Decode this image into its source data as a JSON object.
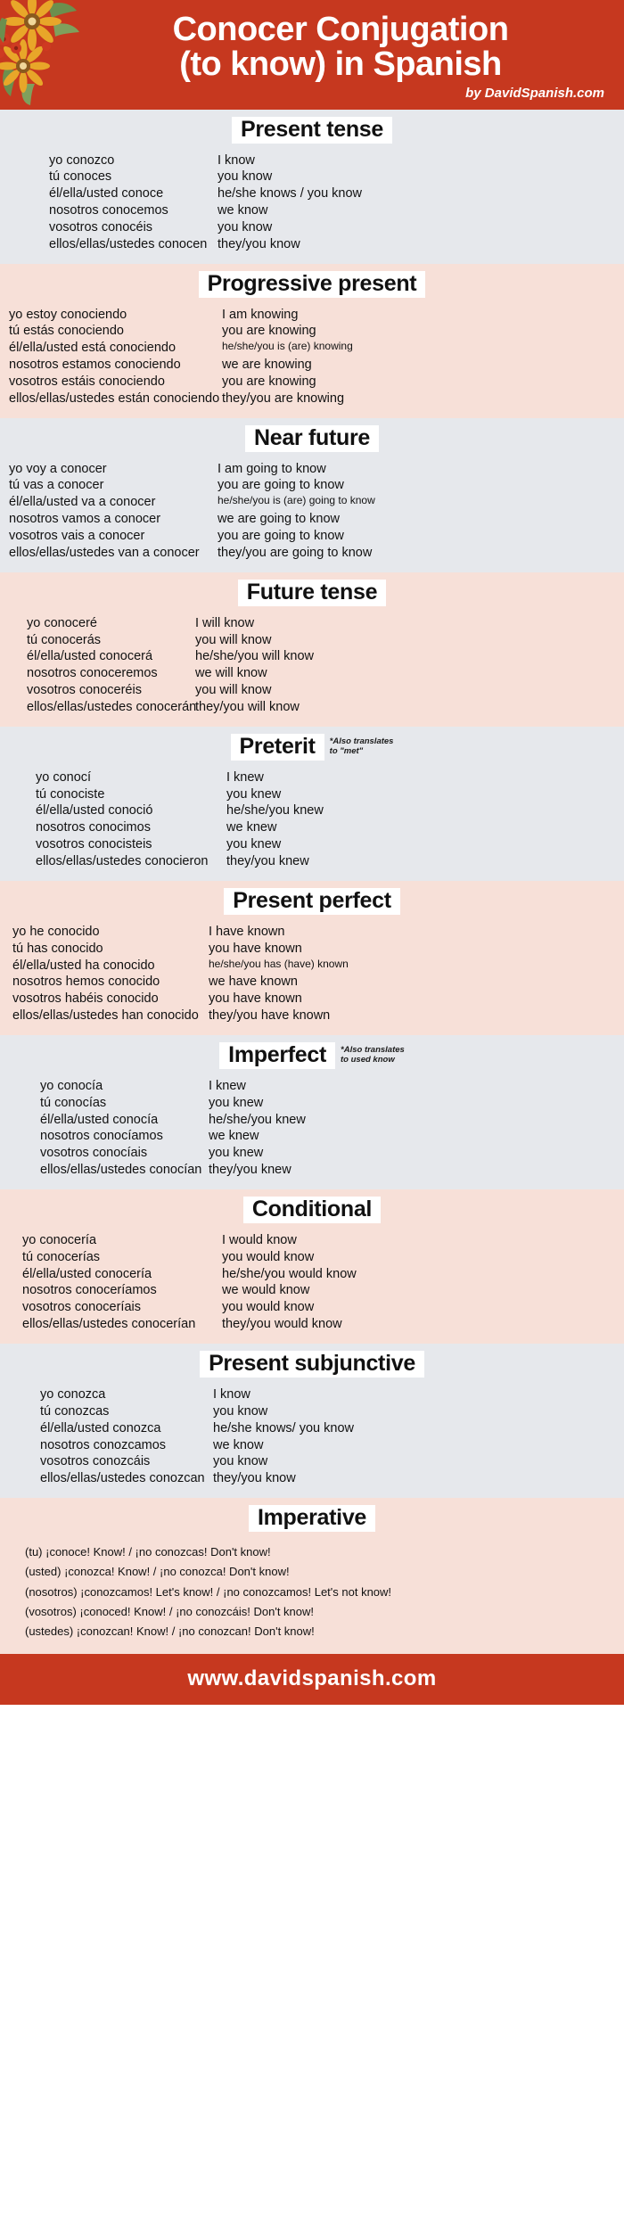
{
  "header": {
    "title_line1": "Conocer Conjugation",
    "title_line2": "(to know) in Spanish",
    "byline": "by DavidSpanish.com",
    "bg_color": "#c6381f",
    "text_color": "#ffffff",
    "decoration_icon": "sunflower-floral-icon"
  },
  "colors": {
    "brand_red": "#c6381f",
    "section_grey": "#e6e8ec",
    "section_pink": "#f7e0d8",
    "title_chip": "#ffffff",
    "body_text": "#111111"
  },
  "sections": [
    {
      "id": "present",
      "title": "Present tense",
      "note": "",
      "bg": "grey",
      "rows": [
        {
          "es": "yo conozco",
          "en": "I know"
        },
        {
          "es": "tú conoces",
          "en": "you know"
        },
        {
          "es": "él/ella/usted conoce",
          "en": "he/she knows / you know"
        },
        {
          "es": "nosotros conocemos",
          "en": "we know"
        },
        {
          "es": "vosotros conocéis",
          "en": "you know"
        },
        {
          "es": "ellos/ellas/ustedes conocen",
          "en": "they/you know"
        }
      ]
    },
    {
      "id": "progressive-present",
      "title": "Progressive present",
      "note": "",
      "bg": "pink",
      "rows": [
        {
          "es": "yo estoy conociendo",
          "en": "I am knowing"
        },
        {
          "es": "tú estás conociendo",
          "en": "you are knowing"
        },
        {
          "es": "él/ella/usted está conociendo",
          "en": "he/she/you is (are) knowing"
        },
        {
          "es": "nosotros estamos conociendo",
          "en": "we are knowing"
        },
        {
          "es": "vosotros estáis conociendo",
          "en": "you are knowing"
        },
        {
          "es": "ellos/ellas/ustedes están conociendo",
          "en": "they/you are knowing"
        }
      ]
    },
    {
      "id": "near-future",
      "title": "Near future",
      "note": "",
      "bg": "grey",
      "rows": [
        {
          "es": "yo voy a conocer",
          "en": "I am going to know"
        },
        {
          "es": "tú vas a conocer",
          "en": "you are going to know"
        },
        {
          "es": "él/ella/usted va a conocer",
          "en": "he/she/you is (are) going to know"
        },
        {
          "es": "nosotros vamos a conocer",
          "en": "we are going to know"
        },
        {
          "es": "vosotros vais a conocer",
          "en": "you are going to know"
        },
        {
          "es": "ellos/ellas/ustedes van a conocer",
          "en": "they/you are going to know"
        }
      ]
    },
    {
      "id": "future",
      "title": "Future tense",
      "note": "",
      "bg": "pink",
      "rows": [
        {
          "es": "yo conoceré",
          "en": "I will know"
        },
        {
          "es": "tú conocerás",
          "en": "you will know"
        },
        {
          "es": "él/ella/usted conocerá",
          "en": "he/she/you will know"
        },
        {
          "es": "nosotros conoceremos",
          "en": "we will know"
        },
        {
          "es": "vosotros conoceréis",
          "en": "you will know"
        },
        {
          "es": "ellos/ellas/ustedes conocerán",
          "en": "they/you will know"
        }
      ]
    },
    {
      "id": "preterit",
      "title": "Preterit",
      "note": "*Also translates\nto \"met\"",
      "bg": "grey",
      "rows": [
        {
          "es": "yo conocí",
          "en": "I knew"
        },
        {
          "es": "tú conociste",
          "en": "you knew"
        },
        {
          "es": "él/ella/usted conoció",
          "en": "he/she/you knew"
        },
        {
          "es": "nosotros conocimos",
          "en": "we knew"
        },
        {
          "es": "vosotros conocisteis",
          "en": "you knew"
        },
        {
          "es": "ellos/ellas/ustedes conocieron",
          "en": "they/you knew"
        }
      ]
    },
    {
      "id": "present-perfect",
      "title": "Present perfect",
      "note": "",
      "bg": "pink",
      "rows": [
        {
          "es": "yo he conocido",
          "en": "I have known"
        },
        {
          "es": "tú has conocido",
          "en": "you have known"
        },
        {
          "es": "él/ella/usted ha conocido",
          "en": "he/she/you has (have) known"
        },
        {
          "es": "nosotros hemos conocido",
          "en": "we have known"
        },
        {
          "es": "vosotros habéis conocido",
          "en": "you have known"
        },
        {
          "es": "ellos/ellas/ustedes han conocido",
          "en": "they/you have known"
        }
      ]
    },
    {
      "id": "imperfect",
      "title": "Imperfect",
      "note": "*Also translates\nto used know",
      "bg": "grey",
      "rows": [
        {
          "es": "yo conocía",
          "en": "I knew"
        },
        {
          "es": "tú conocías",
          "en": "you knew"
        },
        {
          "es": "él/ella/usted conocía",
          "en": "he/she/you knew"
        },
        {
          "es": "nosotros conocíamos",
          "en": "we knew"
        },
        {
          "es": "vosotros conocíais",
          "en": "you knew"
        },
        {
          "es": "ellos/ellas/ustedes conocían",
          "en": "they/you knew"
        }
      ]
    },
    {
      "id": "conditional",
      "title": "Conditional",
      "note": "",
      "bg": "pink",
      "rows": [
        {
          "es": "yo conocería",
          "en": "I would know"
        },
        {
          "es": "tú conocerías",
          "en": "you would know"
        },
        {
          "es": "él/ella/usted conocería",
          "en": "he/she/you would know"
        },
        {
          "es": "nosotros conoceríamos",
          "en": "we would know"
        },
        {
          "es": "vosotros conoceríais",
          "en": "you would know"
        },
        {
          "es": "ellos/ellas/ustedes conocerían",
          "en": "they/you would know"
        }
      ]
    },
    {
      "id": "present-subjunctive",
      "title": "Present subjunctive",
      "note": "",
      "bg": "grey",
      "rows": [
        {
          "es": "yo conozca",
          "en": "I know"
        },
        {
          "es": "tú conozcas",
          "en": "you know"
        },
        {
          "es": "él/ella/usted conozca",
          "en": "he/she knows/ you know"
        },
        {
          "es": "nosotros conozcamos",
          "en": "we know"
        },
        {
          "es": "vosotros conozcáis",
          "en": "you know"
        },
        {
          "es": "ellos/ellas/ustedes conozcan",
          "en": "they/you know"
        }
      ]
    }
  ],
  "imperative": {
    "title": "Imperative",
    "bg": "pink",
    "lines": [
      "(tu) ¡conoce! Know! / ¡no conozcas! Don't know!",
      "(usted) ¡conozca! Know! / ¡no conozca! Don't know!",
      "(nosotros)  ¡conozcamos! Let's know! / ¡no conozcamos! Let's not know!",
      "(vosotros) ¡conoced! Know! / ¡no conozcáis! Don't know!",
      "(ustedes) ¡conozcan! Know! / ¡no conozcan! Don't know!"
    ]
  },
  "footer": {
    "text": "www.davidspanish.com",
    "bg_color": "#c6381f",
    "text_color": "#ffffff"
  }
}
